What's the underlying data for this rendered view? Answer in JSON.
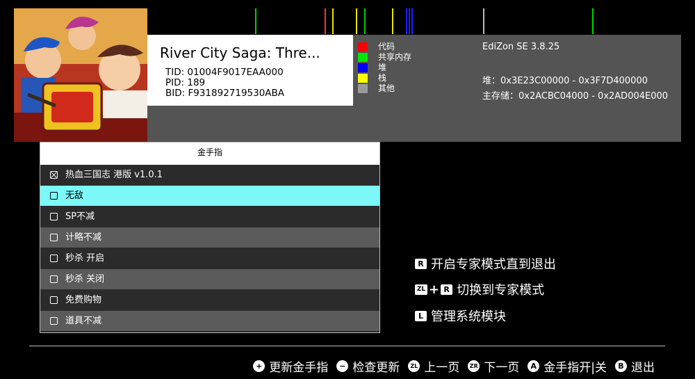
{
  "title_panel": {
    "game_title": "River City Saga: Thre...",
    "tid": "TID: 01004F9017EAA000",
    "pid": "PID: 189",
    "bid": "BID: F931892719530ABA"
  },
  "memory_legend": [
    {
      "label": "代码",
      "color": "#ff0000"
    },
    {
      "label": "共享内存",
      "color": "#00e600"
    },
    {
      "label": "堆",
      "color": "#0000ff"
    },
    {
      "label": "栈",
      "color": "#ffff00"
    },
    {
      "label": "其他",
      "color": "#9a9a9a"
    }
  ],
  "info": {
    "version": "EdiZon SE 3.8.25",
    "heap": "堆：0x3E23C00000 - 0x3F7D400000",
    "main": "主存储：0x2ACBC04000 - 0x2AD004E000"
  },
  "cheat_list": {
    "header": "金手指",
    "items": [
      {
        "label": "热血三国志 港版 v1.0.1",
        "checked": true
      },
      {
        "label": "无敌",
        "checked": false
      },
      {
        "label": "SP不减",
        "checked": false
      },
      {
        "label": "计略不减",
        "checked": false
      },
      {
        "label": "秒杀 开启",
        "checked": false
      },
      {
        "label": "秒杀 关闭",
        "checked": false
      },
      {
        "label": "免费购物",
        "checked": false
      },
      {
        "label": "道具不减",
        "checked": false
      }
    ]
  },
  "hints": {
    "expert_until_exit": "开启专家模式直到退出",
    "switch_expert": "切换到专家模式",
    "manage_modules": "管理系统模块",
    "key_r": "R",
    "key_zl": "ZL",
    "key_l": "L",
    "plus": "+"
  },
  "footer": {
    "update_cheats": "更新金手指",
    "check_update": "检查更新",
    "prev_page": "上一页",
    "next_page": "下一页",
    "toggle_cheat": "金手指开|关",
    "exit": "退出",
    "key_plus": "+",
    "key_minus": "−",
    "key_zl": "ZL",
    "key_zr": "ZR",
    "key_a": "A",
    "key_b": "B"
  }
}
